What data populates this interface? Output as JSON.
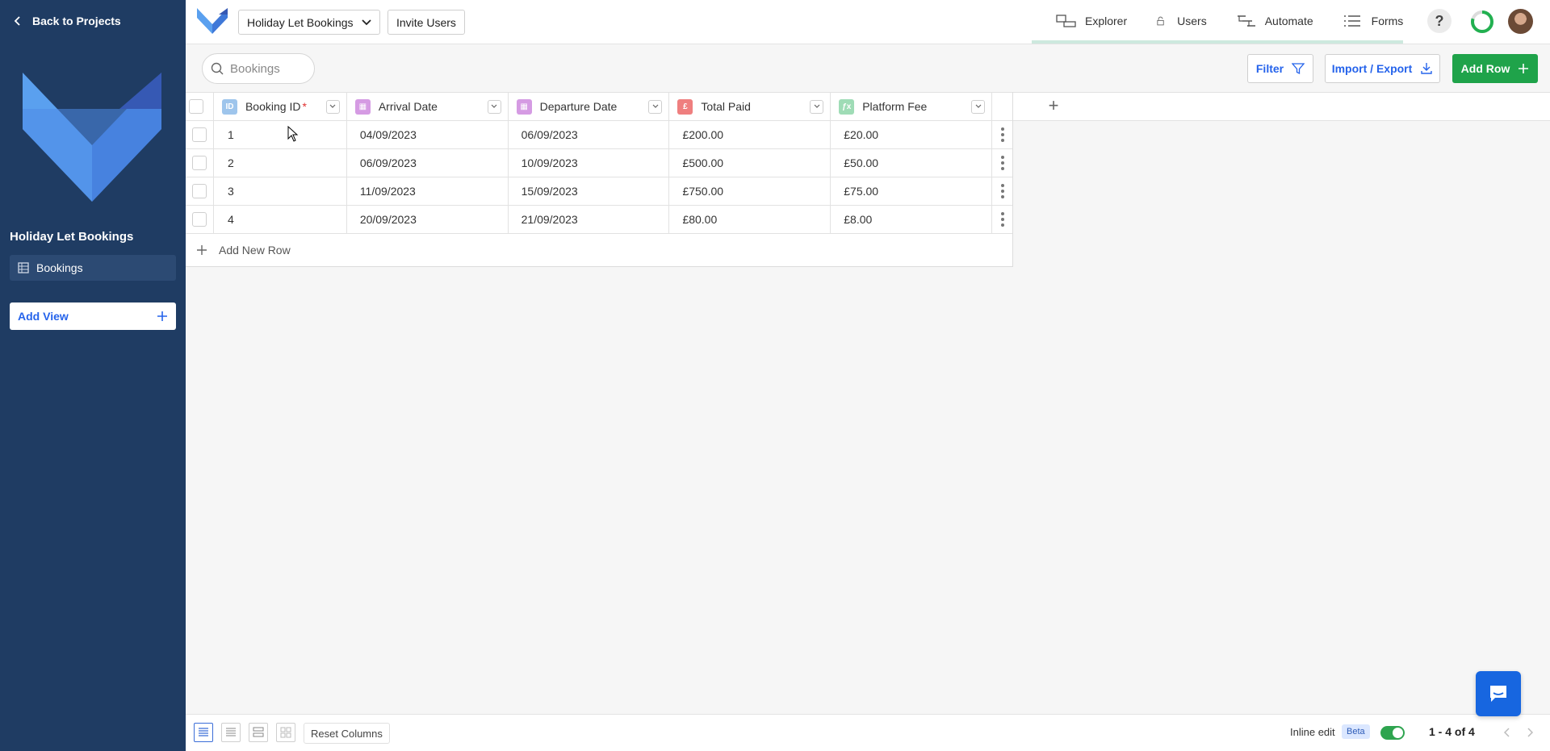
{
  "sidebar": {
    "back_label": "Back to Projects",
    "project_name": "Holiday Let Bookings",
    "nav_items": [
      {
        "label": "Bookings"
      }
    ],
    "add_view_label": "Add View"
  },
  "topbar": {
    "project_select": "Holiday Let Bookings",
    "invite_label": "Invite Users",
    "tabs": [
      {
        "label": "Explorer",
        "icon": "explorer-icon"
      },
      {
        "label": "Users",
        "icon": "lock-icon"
      },
      {
        "label": "Automate",
        "icon": "automate-icon"
      },
      {
        "label": "Forms",
        "icon": "forms-icon"
      }
    ],
    "help_label": "?"
  },
  "toolbar": {
    "search_placeholder": "Bookings",
    "filter_label": "Filter",
    "import_label": "Import / Export",
    "add_row_label": "Add Row"
  },
  "table": {
    "columns": [
      {
        "label": "Booking ID",
        "icon_text": "ID",
        "icon_color": "#9ec5ec",
        "required": "*"
      },
      {
        "label": "Arrival Date",
        "icon_text": "▦",
        "icon_color": "#d59be3"
      },
      {
        "label": "Departure Date",
        "icon_text": "▦",
        "icon_color": "#d59be3"
      },
      {
        "label": "Total Paid",
        "icon_text": "£",
        "icon_color": "#ef7f7f"
      },
      {
        "label": "Platform Fee",
        "icon_text": "ƒx",
        "icon_color": "#9fdcb6"
      }
    ],
    "rows": [
      [
        "1",
        "04/09/2023",
        "06/09/2023",
        "£200.00",
        "£20.00"
      ],
      [
        "2",
        "06/09/2023",
        "10/09/2023",
        "£500.00",
        "£50.00"
      ],
      [
        "3",
        "11/09/2023",
        "15/09/2023",
        "£750.00",
        "£75.00"
      ],
      [
        "4",
        "20/09/2023",
        "21/09/2023",
        "£80.00",
        "£8.00"
      ]
    ],
    "add_new_row_label": "Add New Row"
  },
  "footer": {
    "reset_columns_label": "Reset Columns",
    "inline_edit_label": "Inline edit",
    "beta_label": "Beta",
    "inline_edit_enabled": true,
    "pagination": "1 - 4 of 4"
  },
  "colors": {
    "sidebar_bg": "#1f3c63",
    "primary_blue": "#2563eb",
    "add_row_green": "#1fa34a"
  }
}
